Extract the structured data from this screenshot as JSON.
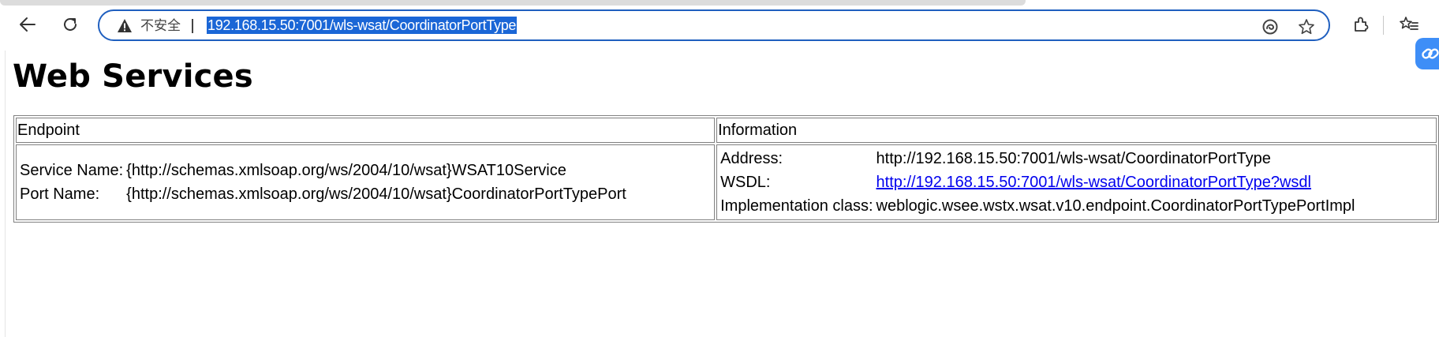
{
  "browser": {
    "security_label": "不安全",
    "url": "192.168.15.50:7001/wls-wsat/CoordinatorPortType",
    "icons": {
      "back": "back-arrow-icon",
      "reload": "reload-icon",
      "warning": "warning-icon",
      "edge_read": "immersive-reader-icon",
      "favorite": "star-icon",
      "extensions": "extensions-icon",
      "favorites_bar": "favorites-icon"
    },
    "accent_color": "#1a66d6"
  },
  "page": {
    "title": "Web Services",
    "table": {
      "headers": {
        "endpoint": "Endpoint",
        "information": "Information"
      },
      "endpoint": {
        "service_name_label": "Service Name:",
        "service_name_value": "{http://schemas.xmlsoap.org/ws/2004/10/wsat}WSAT10Service",
        "port_name_label": "Port Name:",
        "port_name_value": "{http://schemas.xmlsoap.org/ws/2004/10/wsat}CoordinatorPortTypePort"
      },
      "information": {
        "address_label": "Address:",
        "address_value": "http://192.168.15.50:7001/wls-wsat/CoordinatorPortType",
        "wsdl_label": "WSDL:",
        "wsdl_value": "http://192.168.15.50:7001/wls-wsat/CoordinatorPortType?wsdl",
        "impl_label": "Implementation class:",
        "impl_value": "weblogic.wsee.wstx.wsat.v10.endpoint.CoordinatorPortTypePortImpl"
      }
    }
  }
}
